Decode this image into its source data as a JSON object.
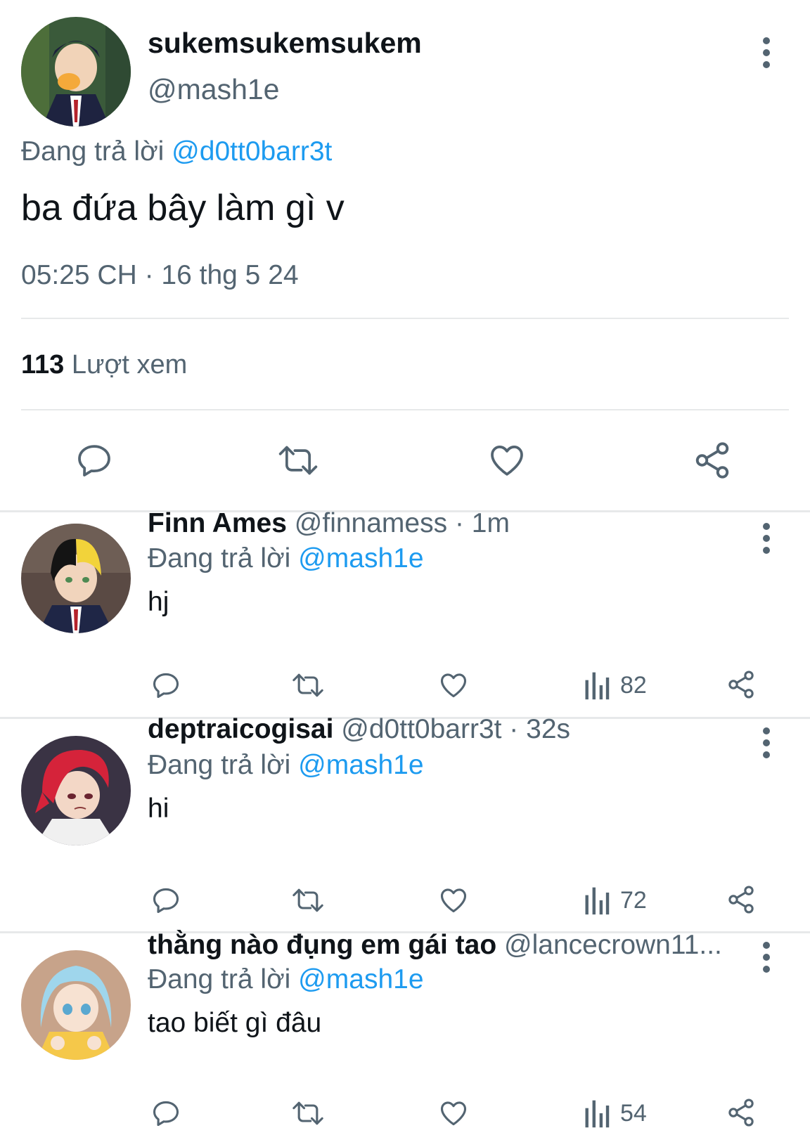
{
  "main_tweet": {
    "display_name": "sukemsukemsukem",
    "handle": "@mash1e",
    "reply_prefix": "Đang trả lời",
    "reply_to": "@d0tt0barr3t",
    "text": "ba đứa bây làm gì v",
    "timestamp": "05:25 CH · 16 thg 5 24",
    "views_count": "113",
    "views_label": "Lượt xem"
  },
  "replies": [
    {
      "name": "Finn Ames",
      "handle_time": "@finnamess · 1m",
      "reply_prefix": "Đang trả lời",
      "reply_to": "@mash1e",
      "text": "hj",
      "views": "82"
    },
    {
      "name": "deptraicogisai",
      "handle_time": "@d0tt0barr3t · 32s",
      "reply_prefix": "Đang trả lời",
      "reply_to": "@mash1e",
      "text": "hi",
      "views": "72"
    },
    {
      "name": "thằng nào đụng em gái tao",
      "handle_time": "@lancecrown11...",
      "reply_prefix": "Đang trả lời",
      "reply_to": "@mash1e",
      "text": "tao biết gì đâu",
      "views": "54"
    }
  ],
  "icons": {
    "reply": "speech-bubble-icon",
    "retweet": "retweet-icon",
    "like": "heart-icon",
    "views": "bar-chart-icon",
    "share": "share-icon",
    "more": "kebab-menu-icon"
  },
  "colors": {
    "link": "#1d9bf0",
    "secondary_text": "#536471",
    "divider": "#e7e9ea"
  }
}
